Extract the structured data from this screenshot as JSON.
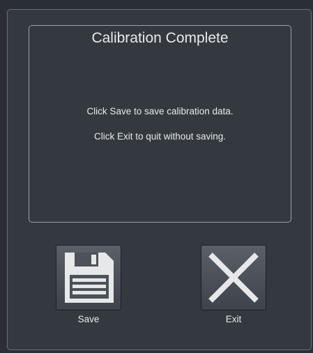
{
  "dialog": {
    "title": "Calibration Complete",
    "messages": [
      "Click Save to save calibration data.",
      "Click Exit to quit without saving."
    ]
  },
  "buttons": {
    "save": {
      "label": "Save",
      "icon": "floppy-disk-icon"
    },
    "exit": {
      "label": "Exit",
      "icon": "close-x-icon"
    }
  },
  "colors": {
    "background": "#343940",
    "panel_border": "#9ea3ab",
    "text": "#e8eaed",
    "icon": "#e6e8ea"
  }
}
